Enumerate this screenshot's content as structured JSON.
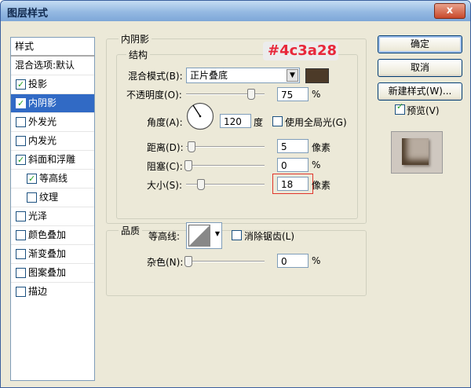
{
  "window": {
    "title": "图层样式",
    "close": "x"
  },
  "side": {
    "header": "样式",
    "blend_default": "混合选项:默认",
    "items": [
      {
        "label": "投影",
        "checked": true
      },
      {
        "label": "内阴影",
        "checked": true,
        "selected": true
      },
      {
        "label": "外发光",
        "checked": false
      },
      {
        "label": "内发光",
        "checked": false
      },
      {
        "label": "斜面和浮雕",
        "checked": true
      },
      {
        "label": "等高线",
        "checked": true,
        "sub": true
      },
      {
        "label": "纹理",
        "checked": false,
        "sub": true
      },
      {
        "label": "光泽",
        "checked": false
      },
      {
        "label": "颜色叠加",
        "checked": false
      },
      {
        "label": "渐变叠加",
        "checked": false
      },
      {
        "label": "图案叠加",
        "checked": false
      },
      {
        "label": "描边",
        "checked": false
      }
    ]
  },
  "buttons": {
    "ok": "确定",
    "cancel": "取消",
    "new_style": "新建样式(W)...",
    "preview": "预览(V)",
    "preview_checked": true
  },
  "inner_shadow": {
    "section_title": "内阴影",
    "structure_title": "结构",
    "blend_mode_label": "混合模式(B):",
    "blend_mode_value": "正片叠底",
    "color_hex": "#4c3a28",
    "color_annotation": "#4c3a28",
    "opacity_label": "不透明度(O):",
    "opacity_value": "75",
    "opacity_unit": "%",
    "angle_label": "角度(A):",
    "angle_value": "120",
    "angle_unit": "度",
    "global_light_label": "使用全局光(G)",
    "global_light_checked": false,
    "distance_label": "距离(D):",
    "distance_value": "5",
    "distance_unit": "像素",
    "choke_label": "阻塞(C):",
    "choke_value": "0",
    "choke_unit": "%",
    "size_label": "大小(S):",
    "size_value": "18",
    "size_unit": "像素"
  },
  "quality": {
    "title": "品质",
    "contour_label": "等高线:",
    "anti_alias_label": "消除锯齿(L)",
    "anti_alias_checked": false,
    "noise_label": "杂色(N):",
    "noise_value": "0",
    "noise_unit": "%"
  },
  "colors": {
    "accent": "#316ac5",
    "annotation_text": "#e8273a",
    "swatch": "#4c3a28"
  }
}
